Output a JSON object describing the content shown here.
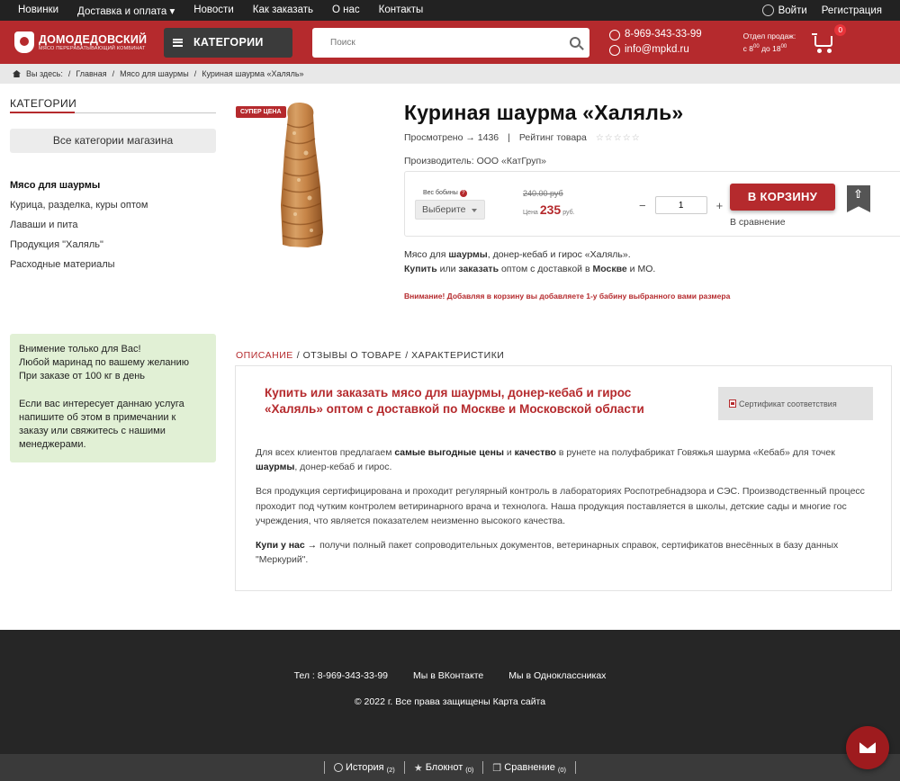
{
  "topnav": {
    "items": [
      {
        "label": "Новинки"
      },
      {
        "label": "Доставка и оплата ▾"
      },
      {
        "label": "Новости"
      },
      {
        "label": "Как заказать"
      },
      {
        "label": "О нас"
      },
      {
        "label": "Контакты"
      }
    ],
    "login": "Войти",
    "register": "Регистрация"
  },
  "header": {
    "logo_line1": "ДОМОДЕДОВСКИЙ",
    "logo_line2": "МЯСО ПЕРЕРАБАТЫВАЮЩИЙ КОМБИНАТ",
    "categories_button": "КАТЕГОРИИ",
    "search_placeholder": "Поиск",
    "phone": "8-969-343-33-99",
    "email": "info@mpkd.ru",
    "hours_title": "Отдел продаж:",
    "hours_from": "с 8",
    "hours_from_sup": "00",
    "hours_to": " до 18",
    "hours_to_sup": "00",
    "cart_count": "0",
    "accent_color": "#b52a2d"
  },
  "breadcrumb": {
    "prefix": "Вы здесь:",
    "items": [
      "Главная",
      "Мясо для шаурмы",
      "Куриная шаурма «Халяль»"
    ]
  },
  "sidebar": {
    "title": "КАТЕГОРИИ",
    "all_categories": "Все категории магазина",
    "items": [
      {
        "label": "Мясо для шаурмы"
      },
      {
        "label": "Курица, разделка, куры оптом"
      },
      {
        "label": "Лаваши и пита"
      },
      {
        "label": "Продукция \"Халяль\""
      },
      {
        "label": "Расходные материалы"
      }
    ],
    "promo": {
      "title": "Внимение только для Вас!",
      "line2": "Любой маринад по вашему желанию",
      "line3": "При заказе от 100 кг в день",
      "line4": "Если вас интересует даннаю услуга напишите об этом в примечании к заказу или свяжитесь с нашими менеджерами."
    }
  },
  "product": {
    "badge": "СУПЕР ЦЕНА",
    "title": "Куриная шаурма «Халяль»",
    "views": "Просмотрено → 1436",
    "rating_label": "Рейтинг товара",
    "stars": "☆☆☆☆☆",
    "manufacturer": "Производитель: ООО «КатГруп»",
    "weight_label": "Вес бобины",
    "weight_select": "Выберите",
    "old_price": "240.00 руб",
    "price_label": "Цена",
    "price": "235",
    "price_unit": "руб.",
    "qty": "1",
    "qty_minus": "−",
    "qty_plus": "+",
    "add_to_cart": "В КОРЗИНУ",
    "compare": "В сравнение",
    "desc1_a": "Мясо для ",
    "desc1_b": "шаурмы",
    "desc1_c": ", донер-кебаб и гирос «Халяль».",
    "desc2_a": "Купить",
    "desc2_b": " или ",
    "desc2_c": "заказать",
    "desc2_d": " оптом с доставкой в ",
    "desc2_e": "Москве",
    "desc2_f": " и МО.",
    "warning": "Внимание! Добавляя в корзину вы добавляете 1-у бабину выбранного вами размера"
  },
  "tabs": {
    "description": "ОПИСАНИЕ",
    "reviews": "/ ОТЗЫВЫ О ТОВАРЕ",
    "specs": "/ ХАРАКТЕРИСТИКИ"
  },
  "panel": {
    "title": "Купить или заказать мясо для шаурмы, донер-кебаб и гирос «Халяль» оптом с доставкой по Москве и Московской области",
    "certificate": "Сертификат соответствия",
    "p1_a": "Для всех клиентов предлагаем ",
    "p1_b": "самые выгодные цены",
    "p1_c": " и ",
    "p1_d": "качество",
    "p1_e": " в рунете на полуфабрикат Говяжья шаурма «Кебаб» для точек ",
    "p1_f": "шаурмы",
    "p1_g": ", донер-кебаб и гирос.",
    "p2": "Вся продукция сертифицирована и проходит регулярный контроль в лабораториях Роспотребнадзора и СЭС. Производственный процесс проходит под чутким контролем ветиринарного врача и технолога. Наша продукция поставляется в школы, детские сады и многие гос учреждения, что является показателем неизменно высокого качества.",
    "p3_a": "Купи у нас →",
    "p3_b": " получи полный пакет сопроводительных документов, ветеринарных справок, сертификатов внесённых в базу данных \"Меркурий\"."
  },
  "footer": {
    "phone": "Тел : 8-969-343-33-99",
    "vk": "Мы в ВКонтакте",
    "ok": "Мы в Одноклассниках",
    "copyright": "© 2022 г. Все права защищены Карта сайта"
  },
  "bottombar": {
    "history": "История",
    "history_count": "(2)",
    "notebook": "Блокнот",
    "notebook_count": "(0)",
    "compare": "Сравнение",
    "compare_count": "(0)"
  }
}
